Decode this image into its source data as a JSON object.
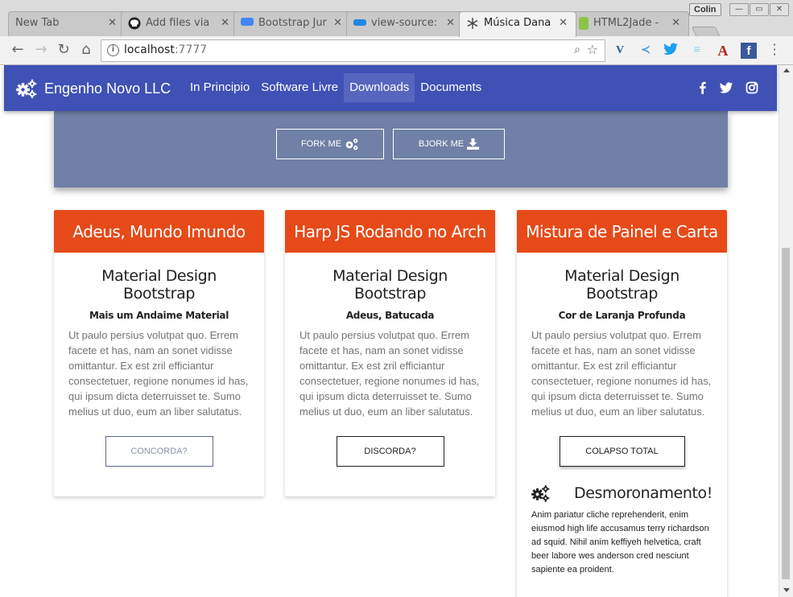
{
  "browser": {
    "tabs": [
      {
        "title": "New Tab",
        "fav": "blank-page-icon",
        "fav_color": "#c9c9c9"
      },
      {
        "title": "Add files via",
        "fav": "github-icon",
        "fav_color": "#222222"
      },
      {
        "title": "Bootstrap Jur",
        "fav": "mdb-icon",
        "fav_color": "#4285f4"
      },
      {
        "title": "view-source:",
        "fav": "source-icon",
        "fav_color": "#1e88e5"
      },
      {
        "title": "Música Dana",
        "fav": "snowflake-icon",
        "fav_color": "#444444"
      },
      {
        "title": "HTML2Jade -",
        "fav": "jade-icon",
        "fav_color": "#8bc34a"
      }
    ],
    "close_glyph": "✕",
    "user_badge": "Colin",
    "window_buttons": [
      "—",
      "▭",
      "✕"
    ],
    "url_host": "localhost",
    "url_port": ":7777",
    "extensions": [
      {
        "name": "vimium-icon",
        "glyph": "V",
        "color": "#2b5b9b"
      },
      {
        "name": "bird-icon",
        "glyph": "≺",
        "color": "#4aa3df"
      },
      {
        "name": "twitter-icon",
        "glyph": "t",
        "color": "#1da1f2"
      },
      {
        "name": "stripes-icon",
        "glyph": "≡",
        "color": "#7fd0f0"
      },
      {
        "name": "font-a-icon",
        "glyph": "A",
        "color": "#b3261e"
      },
      {
        "name": "facebook-icon",
        "glyph": "f",
        "color": "#3b5998"
      }
    ]
  },
  "navbar": {
    "brand": "Engenho Novo LLC",
    "links": [
      "In Principio",
      "Software Livre",
      "Downloads",
      "Documents"
    ],
    "active_index": 2,
    "social": [
      "facebook-icon",
      "twitter-icon",
      "instagram-icon"
    ]
  },
  "hero": {
    "buttons": [
      {
        "label": "FORK ME",
        "icon": "cogs-icon"
      },
      {
        "label": "BJORK ME",
        "icon": "download-icon"
      }
    ]
  },
  "cards": [
    {
      "header": "Adeus, Mundo Imundo",
      "title": "Material Design Bootstrap",
      "subtitle": "Mais um Andaime Material",
      "text": "Ut paulo persius volutpat quo. Errem facete et has, nam an sonet vidisse omittantur. Ex est zril efficiantur consectetuer, regione nonumes id has, qui ipsum dicta deterruisset te. Sumo melius ut duo, eum an liber salutatus.",
      "button": "CONCORDA?"
    },
    {
      "header": "Harp JS Rodando no Arch",
      "title": "Material Design Bootstrap",
      "subtitle": "Adeus, Batucada",
      "text": "Ut paulo persius volutpat quo. Errem facete et has, nam an sonet vidisse omittantur. Ex est zril efficiantur consectetuer, regione nonumes id has, qui ipsum dicta deterruisset te. Sumo melius ut duo, eum an liber salutatus.",
      "button": "DISCORDA?"
    },
    {
      "header": "Mistura de Painel e Carta",
      "title": "Material Design Bootstrap",
      "subtitle": "Cor de Laranja Profunda",
      "text": "Ut paulo persius volutpat quo. Errem facete et has, nam an sonet vidisse omittantur. Ex est zril efficiantur consectetuer, regione nonumes id has, qui ipsum dicta deterruisset te. Sumo melius ut duo, eum an liber salutatus.",
      "button": "COLAPSO TOTAL",
      "extra": {
        "icon": "cogs-icon",
        "title": "Desmoronamento!",
        "text": "Anim pariatur cliche reprehenderit, enim eiusmod high life accusamus terry richardson ad squid. Nihil anim keffiyeh helvetica, craft beer labore wes anderson cred nesciunt sapiente ea proident."
      }
    }
  ],
  "colors": {
    "navbar": "#3f51b5",
    "hero": "#7080a6",
    "card_header": "#e64a19"
  }
}
